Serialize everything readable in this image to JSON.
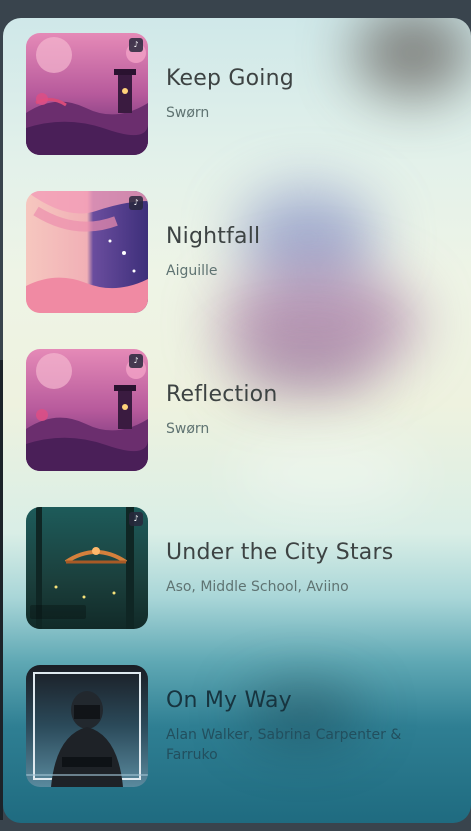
{
  "tracks": [
    {
      "title": "Keep Going",
      "artist": "Swørn",
      "cover_icon": "cherry-blossom-temple-art"
    },
    {
      "title": "Nightfall",
      "artist": "Aiguille",
      "cover_icon": "pink-tree-night-art"
    },
    {
      "title": "Reflection",
      "artist": "Swørn",
      "cover_icon": "cherry-blossom-temple-art"
    },
    {
      "title": "Under the City Stars",
      "artist": "Aso, Middle School, Aviino",
      "cover_icon": "canary-forest-bridge-art"
    },
    {
      "title": "On My Way",
      "artist": "Alan Walker, Sabrina Carpenter & Farruko",
      "cover_icon": "masked-figure-art"
    }
  ],
  "colors": {
    "title_text": "#3d4343",
    "artist_text": "#5f7372",
    "panel_top": "#cfe8e9",
    "panel_bottom": "#1f6b80"
  }
}
